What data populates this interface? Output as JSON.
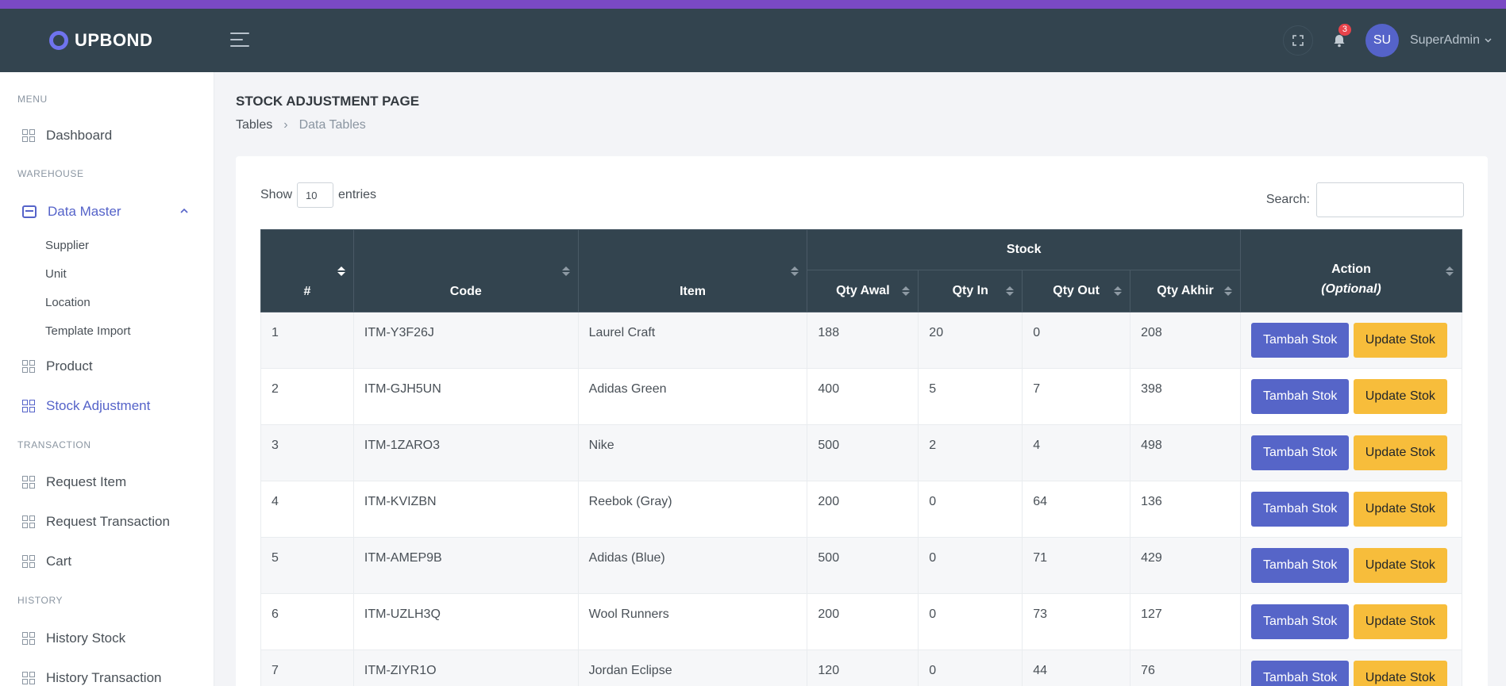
{
  "brand": {
    "name": "UPBOND"
  },
  "topbar": {
    "notification_count": "3",
    "avatar_initials": "SU",
    "user_name": "SuperAdmin"
  },
  "sidebar": {
    "sections": {
      "menu": "MENU",
      "warehouse": "WAREHOUSE",
      "transaction": "TRANSACTION",
      "history": "HISTORY"
    },
    "items": {
      "dashboard": "Dashboard",
      "data_master": "Data Master",
      "supplier": "Supplier",
      "unit": "Unit",
      "location": "Location",
      "template_import": "Template Import",
      "product": "Product",
      "stock_adjustment": "Stock Adjustment",
      "request_item": "Request Item",
      "request_transaction": "Request Transaction",
      "cart": "Cart",
      "history_stock": "History Stock",
      "history_transaction": "History Transaction"
    }
  },
  "page": {
    "title": "STOCK ADJUSTMENT PAGE",
    "breadcrumb": [
      "Tables",
      "Data Tables"
    ]
  },
  "table_controls": {
    "show_label": "Show",
    "entries_value": "10",
    "entries_label": "entries",
    "search_label": "Search:"
  },
  "table": {
    "headers": {
      "num": "#",
      "code": "Code",
      "item": "Item",
      "stock_group": "Stock",
      "qty_awal": "Qty Awal",
      "qty_in": "Qty In",
      "qty_out": "Qty Out",
      "qty_akhir": "Qty Akhir",
      "action": "Action",
      "action_note": "(Optional)"
    },
    "buttons": {
      "tambah": "Tambah Stok",
      "update": "Update Stok"
    },
    "rows": [
      {
        "num": "1",
        "code": "ITM-Y3F26J",
        "item": "Laurel Craft",
        "qty_awal": "188",
        "qty_in": "20",
        "qty_out": "0",
        "qty_akhir": "208"
      },
      {
        "num": "2",
        "code": "ITM-GJH5UN",
        "item": "Adidas Green",
        "qty_awal": "400",
        "qty_in": "5",
        "qty_out": "7",
        "qty_akhir": "398"
      },
      {
        "num": "3",
        "code": "ITM-1ZARO3",
        "item": "Nike",
        "qty_awal": "500",
        "qty_in": "2",
        "qty_out": "4",
        "qty_akhir": "498"
      },
      {
        "num": "4",
        "code": "ITM-KVIZBN",
        "item": "Reebok (Gray)",
        "qty_awal": "200",
        "qty_in": "0",
        "qty_out": "64",
        "qty_akhir": "136"
      },
      {
        "num": "5",
        "code": "ITM-AMEP9B",
        "item": "Adidas (Blue)",
        "qty_awal": "500",
        "qty_in": "0",
        "qty_out": "71",
        "qty_akhir": "429"
      },
      {
        "num": "6",
        "code": "ITM-UZLH3Q",
        "item": "Wool Runners",
        "qty_awal": "200",
        "qty_in": "0",
        "qty_out": "73",
        "qty_akhir": "127"
      },
      {
        "num": "7",
        "code": "ITM-ZIYR1O",
        "item": "Jordan Eclipse",
        "qty_awal": "120",
        "qty_in": "0",
        "qty_out": "44",
        "qty_akhir": "76"
      }
    ]
  },
  "colors": {
    "topbar": "#33444f",
    "accent_stripe": "#7a49c4",
    "primary": "#5665c8",
    "warning": "#f7bd3b"
  },
  "icons": {
    "menu_items": "grid-icon",
    "data_master": "store-icon",
    "fullscreen": "fullscreen-icon",
    "notifications": "bell-icon"
  }
}
